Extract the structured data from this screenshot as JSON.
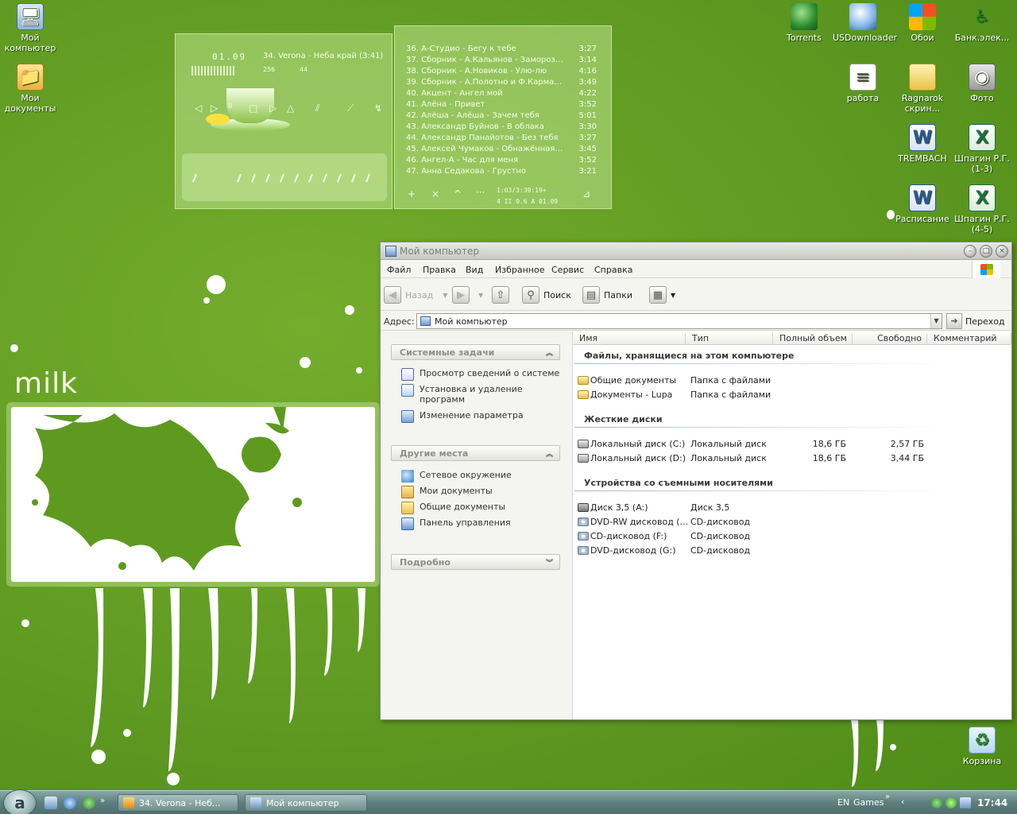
{
  "desktop": {
    "left_icons": [
      {
        "label": "Мой компьютер",
        "icon": "my-computer-icon"
      },
      {
        "label": "Мои документы",
        "icon": "my-documents-icon"
      }
    ],
    "top_right_icons": [
      {
        "label": "Torrents",
        "icon": "utorrent-globe-icon"
      },
      {
        "label": "USDownloader",
        "icon": "downloader-icon"
      },
      {
        "label": "Обои",
        "icon": "windows-flag-icon"
      },
      {
        "label": "Банк.элек...",
        "icon": "accessibility-icon"
      }
    ],
    "grid_icons": [
      {
        "label": "работа",
        "icon": "text-file-icon"
      },
      {
        "label": "Ragnarok скрин...",
        "icon": "folder-icon"
      },
      {
        "label": "Фото",
        "icon": "camera-icon"
      },
      {
        "label": "TREMBACH",
        "icon": "word-document-icon"
      },
      {
        "label": "Шпагин Р.Г. (1-3)",
        "icon": "excel-document-icon"
      },
      {
        "label": "Расписание",
        "icon": "word-document-icon"
      },
      {
        "label": "Шпагин Р.Г. (4-5)",
        "icon": "excel-document-icon"
      }
    ],
    "recycle_bin": {
      "label": "Корзина",
      "icon": "recycle-bin-icon"
    },
    "widget_label": "milk"
  },
  "player": {
    "time": "01.09",
    "now_playing": "34. Verona - Неба край (3:41)",
    "kbps": "256",
    "khz": "44",
    "status_line1": "1:03/3:39:19+",
    "status_line2": "4  II 0.6 A    01.09",
    "playlist": [
      {
        "title": "36. А-Студио - Бегу к тебе",
        "duration": "3:27"
      },
      {
        "title": "37. Сборник - А.Кальянов - Заморозки",
        "duration": "3:14"
      },
      {
        "title": "38. Сборник - А.Новиков - Улю-лю",
        "duration": "4:16"
      },
      {
        "title": "39. Сборник - А.Полотно и Ф.Карманов ...",
        "duration": "3:49"
      },
      {
        "title": "40. Акцент - Ангел мой",
        "duration": "4:22"
      },
      {
        "title": "41. Алёна - Привет",
        "duration": "3:52"
      },
      {
        "title": "42. Алёша - Алёша - Зачем тебя",
        "duration": "5:01"
      },
      {
        "title": "43. Александр Буйнов - В облака",
        "duration": "3:30"
      },
      {
        "title": "44. Александр Панайотов - Без тебя",
        "duration": "3:27"
      },
      {
        "title": "45. Алексей Чумаков - Обнажённая нат...",
        "duration": "3:45"
      },
      {
        "title": "46. Ангел-А - Час для меня",
        "duration": "3:52"
      },
      {
        "title": "47. Анна Седакова - Грустно",
        "duration": "3:21"
      }
    ]
  },
  "window": {
    "title": "Мой компьютер",
    "menu": [
      "Файл",
      "Правка",
      "Вид",
      "Избранное",
      "Сервис",
      "Справка"
    ],
    "toolbar": {
      "back": "Назад",
      "search": "Поиск",
      "folders": "Папки"
    },
    "address": {
      "label": "Адрес:",
      "value": "Мой компьютер",
      "go": "Переход"
    },
    "sidebar": {
      "system_tasks": {
        "title": "Системные задачи",
        "links": [
          {
            "label": "Просмотр сведений о системе",
            "icon": "system-info-icon"
          },
          {
            "label": "Установка и удаление программ",
            "icon": "add-remove-programs-icon"
          },
          {
            "label": "Изменение параметра",
            "icon": "change-setting-icon"
          }
        ]
      },
      "other_places": {
        "title": "Другие места",
        "links": [
          {
            "label": "Сетевое окружение",
            "icon": "network-icon"
          },
          {
            "label": "Мои документы",
            "icon": "my-documents-icon"
          },
          {
            "label": "Общие документы",
            "icon": "folder-icon"
          },
          {
            "label": "Панель управления",
            "icon": "control-panel-icon"
          }
        ]
      },
      "details": {
        "title": "Подробно"
      }
    },
    "columns": [
      "Имя",
      "Тип",
      "Полный объем",
      "Свободно",
      "Комментарий"
    ],
    "groups": [
      {
        "title": "Файлы, хранящиеся на этом компьютере",
        "items": [
          {
            "name": "Общие документы",
            "type": "Папка с файлами",
            "total": "",
            "free": "",
            "icon": "folder-icon"
          },
          {
            "name": "Документы - Lupa",
            "type": "Папка с файлами",
            "total": "",
            "free": "",
            "icon": "folder-icon"
          }
        ]
      },
      {
        "title": "Жесткие диски",
        "items": [
          {
            "name": "Локальный диск (C:)",
            "type": "Локальный диск",
            "total": "18,6 ГБ",
            "free": "2,57 ГБ",
            "icon": "hard-disk-icon"
          },
          {
            "name": "Локальный диск (D:)",
            "type": "Локальный диск",
            "total": "18,6 ГБ",
            "free": "3,44 ГБ",
            "icon": "hard-disk-icon"
          }
        ]
      },
      {
        "title": "Устройства со съемными носителями",
        "items": [
          {
            "name": "Диск 3,5 (A:)",
            "type": "Диск 3,5",
            "total": "",
            "free": "",
            "icon": "floppy-icon"
          },
          {
            "name": "DVD-RW дисковод (...",
            "type": "CD-дисковод",
            "total": "",
            "free": "",
            "icon": "cd-drive-icon"
          },
          {
            "name": "CD-дисковод (F:)",
            "type": "CD-дисковод",
            "total": "",
            "free": "",
            "icon": "cd-drive-icon"
          },
          {
            "name": "DVD-дисковод (G:)",
            "type": "CD-дисковод",
            "total": "",
            "free": "",
            "icon": "cd-drive-icon"
          }
        ]
      }
    ]
  },
  "taskbar": {
    "tasks": [
      {
        "label": "34. Verona - Неб...",
        "icon": "aimp-icon"
      },
      {
        "label": "Мой компьютер",
        "icon": "my-computer-icon"
      }
    ],
    "lang": "EN",
    "toolbar_name": "Games",
    "clock": "17:44"
  }
}
